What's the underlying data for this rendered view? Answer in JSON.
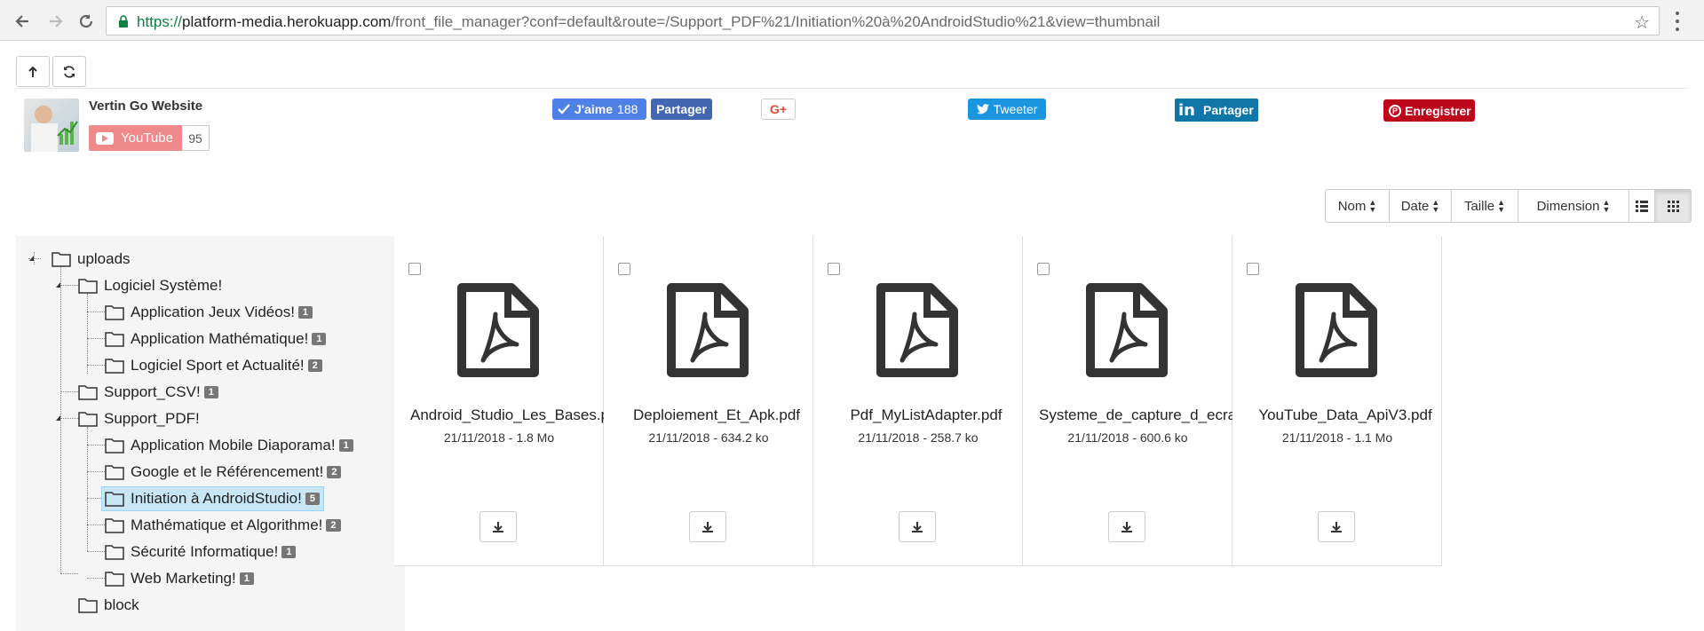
{
  "browser": {
    "url_scheme": "https://",
    "url_host": "platform-media.herokuapp.com",
    "url_path": "/front_file_manager?conf=default&route=/Support_PDF%21/Initiation%20à%20AndroidStudio%21&view=thumbnail"
  },
  "social": {
    "channel_name": "Vertin Go Website",
    "youtube_label": "YouTube",
    "youtube_count": "95",
    "fb_like_label": "J'aime",
    "fb_like_count": "188",
    "fb_share_label": "Partager",
    "gplus_label": "G+",
    "tweet_label": "Tweeter",
    "linkedin_label": "Partager",
    "pinterest_label": "Enregistrer"
  },
  "sortbar": {
    "name": "Nom",
    "date": "Date",
    "size": "Taille",
    "dimension": "Dimension"
  },
  "tree": {
    "root": "uploads",
    "nodes": [
      {
        "label": "Logiciel Système!",
        "badge": ""
      },
      {
        "label": "Application Jeux Vidéos!",
        "badge": "1"
      },
      {
        "label": "Application Mathématique!",
        "badge": "1"
      },
      {
        "label": "Logiciel Sport et Actualité!",
        "badge": "2"
      },
      {
        "label": "Support_CSV!",
        "badge": "1"
      },
      {
        "label": "Support_PDF!",
        "badge": ""
      },
      {
        "label": "Application Mobile Diaporama!",
        "badge": "1"
      },
      {
        "label": "Google et le Référencement!",
        "badge": "2"
      },
      {
        "label": "Initiation à AndroidStudio!",
        "badge": "5"
      },
      {
        "label": "Mathématique et Algorithme!",
        "badge": "2"
      },
      {
        "label": "Sécurité Informatique!",
        "badge": "1"
      },
      {
        "label": "Web Marketing!",
        "badge": "1"
      },
      {
        "label": "block",
        "badge": ""
      }
    ]
  },
  "files": [
    {
      "name": "Android_Studio_Les_Bases.pdf",
      "meta": "21/11/2018 - 1.8 Mo"
    },
    {
      "name": "Deploiement_Et_Apk.pdf",
      "meta": "21/11/2018 - 634.2 ko"
    },
    {
      "name": "Pdf_MyListAdapter.pdf",
      "meta": "21/11/2018 - 258.7 ko"
    },
    {
      "name": "Systeme_de_capture_d_ecran.pdf",
      "meta": "21/11/2018 - 600.6 ko"
    },
    {
      "name": "YouTube_Data_ApiV3.pdf",
      "meta": "21/11/2018 - 1.1 Mo"
    }
  ],
  "colors": {
    "facebook": "#4267b2",
    "twitter": "#1b95e0",
    "linkedin": "#0e76a8",
    "pinterest": "#bd081c",
    "selected_node": "#c9e6f7"
  }
}
